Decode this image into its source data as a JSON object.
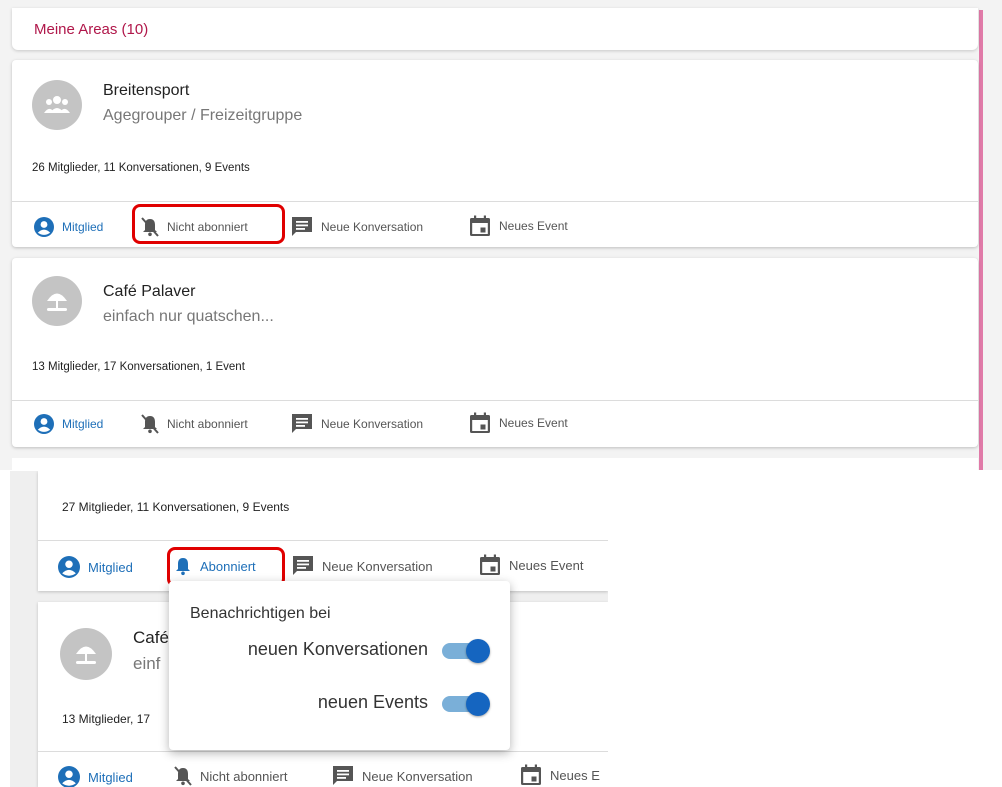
{
  "header": {
    "title": "Meine Areas (10)"
  },
  "areas": [
    {
      "title": "Breitensport",
      "subtitle": "Agegrouper / Freizeitgruppe",
      "stats": "26 Mitglieder, 11 Konversationen, 9 Events",
      "member": "Mitglied",
      "subscription": "Nicht abonniert",
      "new_conversation": "Neue Konversation",
      "new_event": "Neues Event",
      "avatar_icon": "group-icon"
    },
    {
      "title": "Café Palaver",
      "subtitle": "einfach nur quatschen...",
      "stats": "13 Mitglieder, 17 Konversationen, 1 Event",
      "member": "Mitglied",
      "subscription": "Nicht abonniert",
      "new_conversation": "Neue Konversation",
      "new_event": "Neues Event",
      "avatar_icon": "beach-umbrella-icon"
    }
  ],
  "zoom": {
    "card1": {
      "stats": "27 Mitglieder, 11 Konversationen, 9 Events",
      "member": "Mitglied",
      "subscription": "Abonniert",
      "new_conversation": "Neue Konversation",
      "new_event": "Neues Event"
    },
    "card2": {
      "title": "Café",
      "subtitle": "einf",
      "stats": "13 Mitglieder, 17",
      "member": "Mitglied",
      "subscription": "Nicht abonniert",
      "new_conversation": "Neue Konversation",
      "new_event": "Neues E"
    },
    "popup": {
      "title": "Benachrichtigen bei",
      "toggles": [
        {
          "label": "neuen Konversationen",
          "on": true
        },
        {
          "label": "neuen Events",
          "on": true
        }
      ]
    }
  },
  "colors": {
    "header_text": "#b0174a",
    "accent_blue": "#1e6fb8",
    "highlight_red": "#e00000",
    "side_bar_pink": "#e07aa8",
    "toggle_on": "#1565c0"
  }
}
